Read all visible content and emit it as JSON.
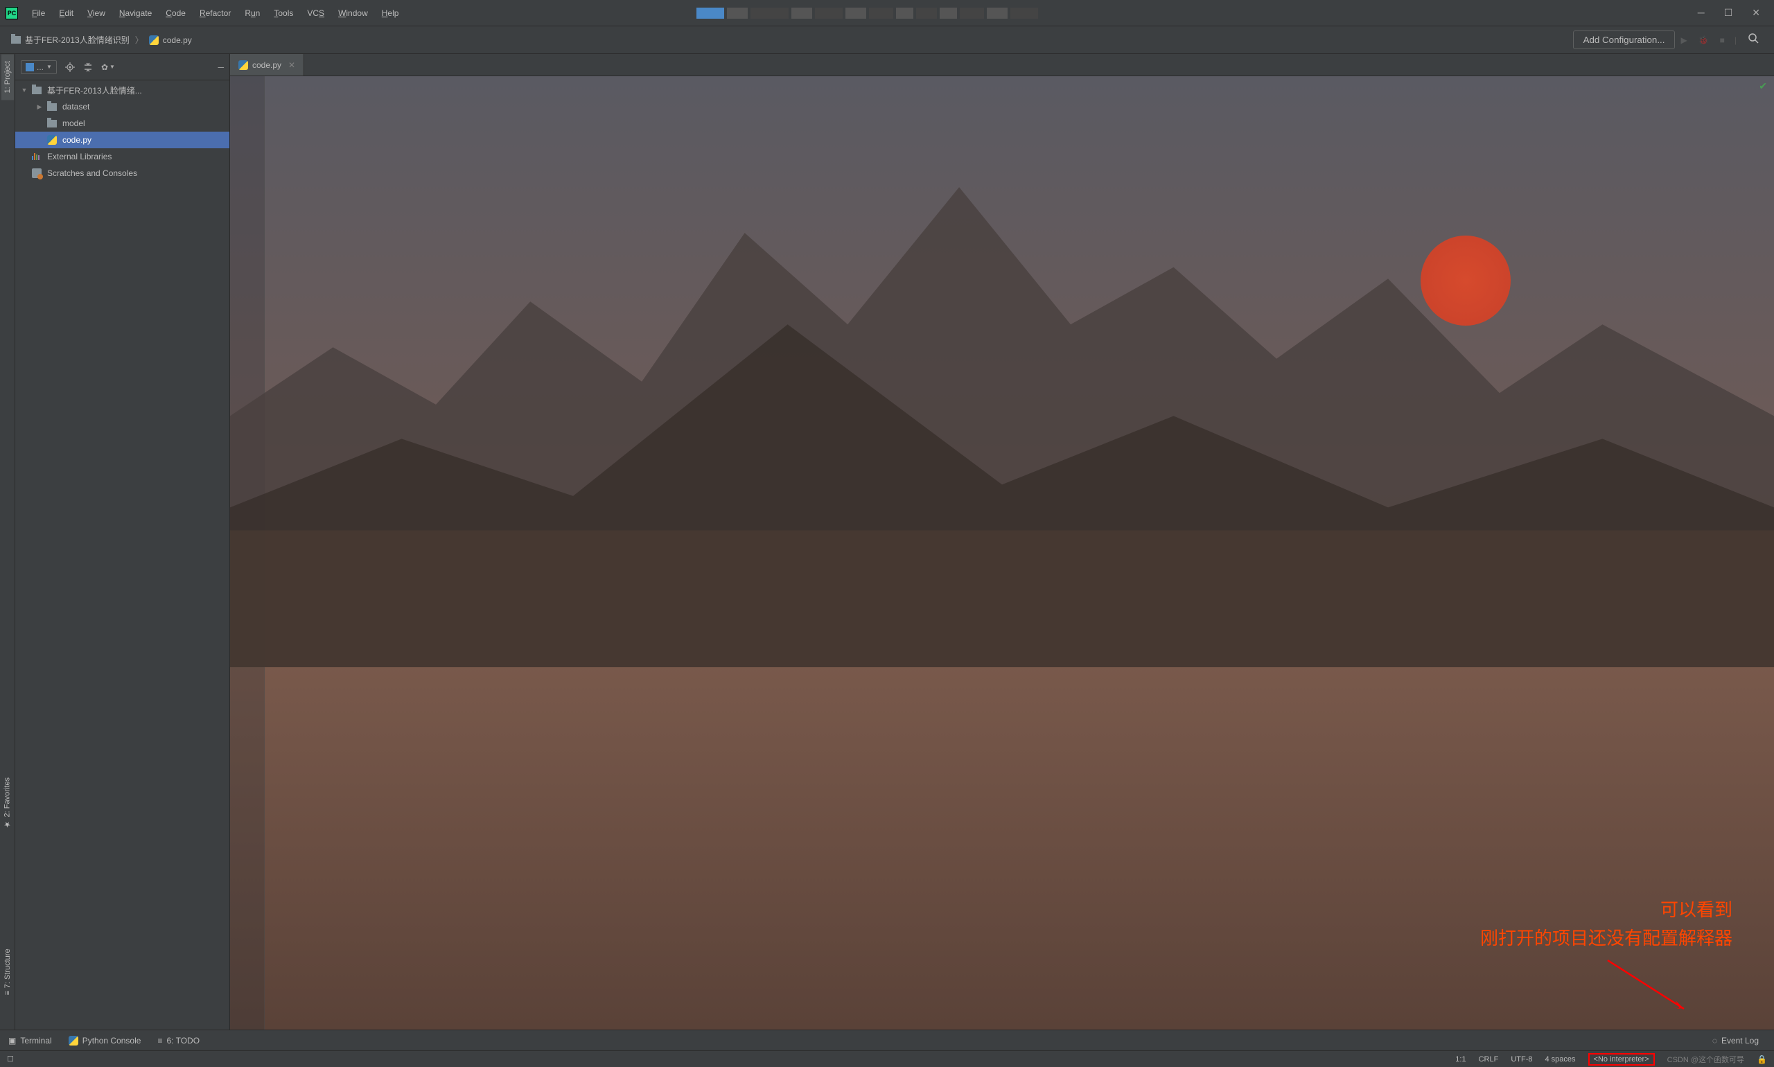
{
  "menubar": {
    "items": [
      "File",
      "Edit",
      "View",
      "Navigate",
      "Code",
      "Refactor",
      "Run",
      "Tools",
      "VCS",
      "Window",
      "Help"
    ]
  },
  "breadcrumb": {
    "project": "基于FER-2013人脸情绪识别",
    "file": "code.py",
    "add_config": "Add Configuration..."
  },
  "left_gutter": {
    "project": "1: Project",
    "favorites": "2: Favorites",
    "structure": "7: Structure"
  },
  "panel_toolbar": {
    "selector": "..."
  },
  "tree": {
    "root": "基于FER-2013人脸情绪...",
    "dataset": "dataset",
    "model": "model",
    "code": "code.py",
    "ext_libs": "External Libraries",
    "scratches": "Scratches and Consoles"
  },
  "tabs": {
    "code": "code.py"
  },
  "annotation": {
    "line1": "可以看到",
    "line2": "刚打开的项目还没有配置解释器"
  },
  "bottom": {
    "terminal": "Terminal",
    "python_console": "Python Console",
    "todo": "6: TODO",
    "event_log": "Event Log"
  },
  "status": {
    "position": "1:1",
    "line_sep": "CRLF",
    "encoding": "UTF-8",
    "indent": "4 spaces",
    "interpreter": "<No interpreter>",
    "watermark": "CSDN @这个函数可导"
  }
}
